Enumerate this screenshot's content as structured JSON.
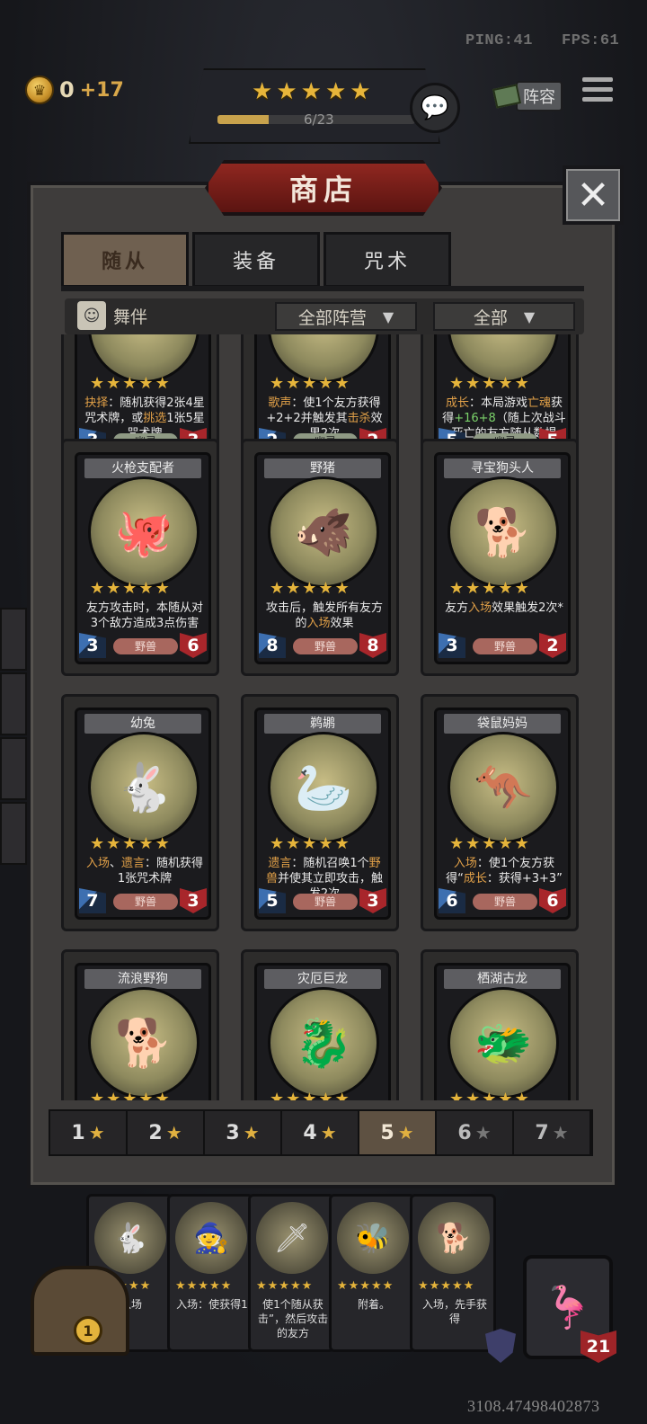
{
  "hud": {
    "ping": "PING:41",
    "fps": "FPS:61",
    "coins": "0",
    "coin_income": "+17",
    "level_stars": 5,
    "xp_text": "6/23",
    "xp_fraction": 0.26,
    "lineup_label": "阵容"
  },
  "shop": {
    "title": "商店",
    "tabs": [
      "随从",
      "装备",
      "咒术"
    ],
    "active_tab": 0,
    "dance_label": "舞伴",
    "filter_faction": "全部阵营",
    "filter_all": "全部",
    "rows": [
      [
        {
          "name": "",
          "desc_html": "<span class='kw'>抉择</span>：随机获得2张4星咒术牌，或<span class='kw'>挑选</span>1张5星咒术牌",
          "atk": "3",
          "hp": "3",
          "tribe": "幽灵",
          "tribe_kind": "ghost"
        },
        {
          "name": "",
          "desc_html": "<span class='kw'>歌声</span>：使1个友方获得+2+2并触发其<span class='kw'>击杀</span>效果2次",
          "atk": "2",
          "hp": "2",
          "tribe": "幽灵",
          "tribe_kind": "ghost"
        },
        {
          "name": "",
          "desc_html": "<span class='kw'>成长</span>：本局游戏<span class='kw'>亡魂</span>获得<span class='green'>+16+8</span>（随上次战斗死亡的友方随从数提升！）",
          "atk": "5",
          "hp": "5",
          "tribe": "幽灵",
          "tribe_kind": "ghost"
        }
      ],
      [
        {
          "name": "火枪支配者",
          "desc_html": "友方攻击时，本随从对3个敌方造成3点伤害",
          "atk": "3",
          "hp": "6",
          "tribe": "野兽",
          "icon": "🐙"
        },
        {
          "name": "野猪",
          "desc_html": "攻击后，触发所有友方的<span class='kw'>入场</span>效果",
          "atk": "8",
          "hp": "8",
          "tribe": "野兽",
          "icon": "🐗"
        },
        {
          "name": "寻宝狗头人",
          "desc_html": "友方<span class='kw'>入场</span>效果触发2次*",
          "atk": "3",
          "hp": "2",
          "tribe": "野兽",
          "icon": "🐕"
        }
      ],
      [
        {
          "name": "幼兔",
          "desc_html": "<span class='kw'>入场</span>、<span class='kw'>遗言</span>：随机获得1张咒术牌",
          "atk": "7",
          "hp": "3",
          "tribe": "野兽",
          "icon": "🐇"
        },
        {
          "name": "鹈鹕",
          "desc_html": "<span class='kw'>遗言</span>：随机召唤1个<span class='kw'>野兽</span>并使其立即攻击，触发2次",
          "atk": "5",
          "hp": "3",
          "tribe": "野兽",
          "icon": "🦢"
        },
        {
          "name": "袋鼠妈妈",
          "desc_html": "<span class='kw'>入场</span>：使1个友方获得“<span class='kw'>成长</span>：获得+3+3”",
          "atk": "6",
          "hp": "6",
          "tribe": "野兽",
          "icon": "🦘"
        }
      ],
      [
        {
          "name": "流浪野狗",
          "desc_html": "",
          "atk": "",
          "hp": "",
          "tribe": "",
          "icon": "🐕"
        },
        {
          "name": "灾厄巨龙",
          "desc_html": "",
          "atk": "",
          "hp": "",
          "tribe": "",
          "icon": "🐉"
        },
        {
          "name": "栖湖古龙",
          "desc_html": "",
          "atk": "",
          "hp": "",
          "tribe": "",
          "icon": "🐲"
        }
      ]
    ],
    "tiers": [
      "1",
      "2",
      "3",
      "4",
      "5",
      "6",
      "7"
    ],
    "active_tier": 4
  },
  "hand": [
    {
      "text": "入场",
      "icon": "🐇"
    },
    {
      "text": "入场：使获得1",
      "icon": "🧙"
    },
    {
      "text": "使1个随从获击”，然后攻击的友方",
      "icon": "🗡"
    },
    {
      "text": "附着。",
      "icon": "🐝"
    },
    {
      "text": "入场，先手获得",
      "icon": "🐕"
    }
  ],
  "chest_count": "1",
  "hero_hp": "21",
  "seed": "3108.47498402873",
  "colors": {
    "accent": "#e5b43b",
    "panel": "#3e3c3b",
    "title_red": "#8f2720",
    "attack": "#3d6fb0",
    "health": "#a8262b"
  }
}
